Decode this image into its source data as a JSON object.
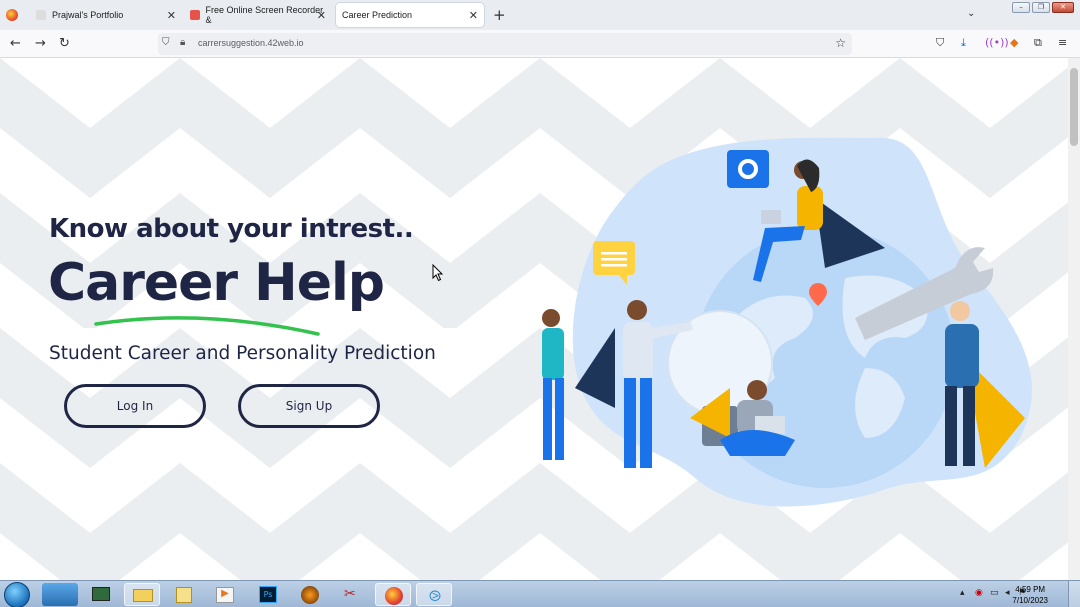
{
  "browser": {
    "tabs": [
      {
        "label": "Prajwal's Portfolio"
      },
      {
        "label": "Free Online Screen Recorder &"
      },
      {
        "label": "Career Prediction"
      }
    ],
    "url": "carrersuggestion.42web.io"
  },
  "hero": {
    "tagline": "Know about your intrest..",
    "title": "Career Help",
    "subtitle": "Student Career and Personality Prediction",
    "login_label": "Log In",
    "signup_label": "Sign Up"
  },
  "taskbar": {
    "time": "4:59 PM",
    "date": "7/10/2023"
  },
  "colors": {
    "brand": "#1f2545",
    "accent_green": "#33c24d",
    "blob": "#cfe4fb"
  }
}
